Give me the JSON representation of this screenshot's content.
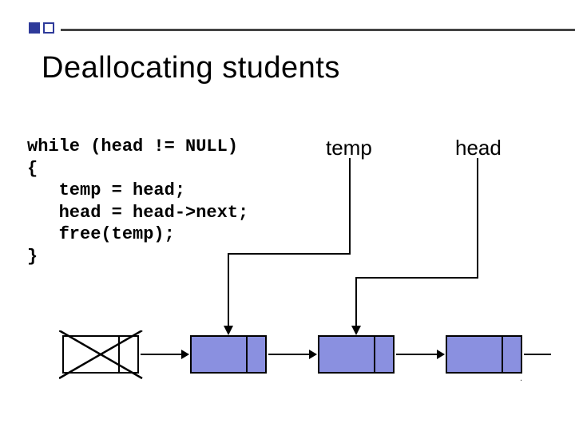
{
  "title": "Deallocating students",
  "code": {
    "l1": "while (head != NULL)",
    "l2": "{",
    "l3": "   temp = head;",
    "l4": "   head = head->next;",
    "l5": "   free(temp);",
    "l6": "}"
  },
  "pointers": {
    "temp": "temp",
    "head": "head"
  },
  "diagram": {
    "nodes": [
      {
        "index": 1,
        "freed": true
      },
      {
        "index": 2,
        "freed": false
      },
      {
        "index": 3,
        "freed": false
      },
      {
        "index": 4,
        "freed": false
      }
    ],
    "temp_points_to_index": 2,
    "head_points_to_index": 3,
    "node_color": "#8a90e0"
  },
  "slide_number": "."
}
